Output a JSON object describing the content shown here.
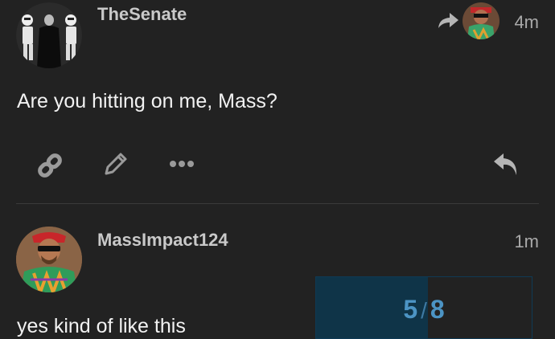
{
  "posts": [
    {
      "username": "TheSenate",
      "time": "4m",
      "text": "Are you hitting on me, Mass?"
    },
    {
      "username": "MassImpact124",
      "time": "1m",
      "text": "yes kind of like this"
    }
  ],
  "actions": {
    "icons": [
      "link-icon",
      "pencil-icon",
      "more-icon",
      "reply-icon"
    ]
  },
  "progress": {
    "current": "5",
    "total": "8",
    "fraction": 0.52
  },
  "colors": {
    "background": "#222222",
    "accent": "#4c94c4",
    "progress_fill": "#0f3448"
  }
}
